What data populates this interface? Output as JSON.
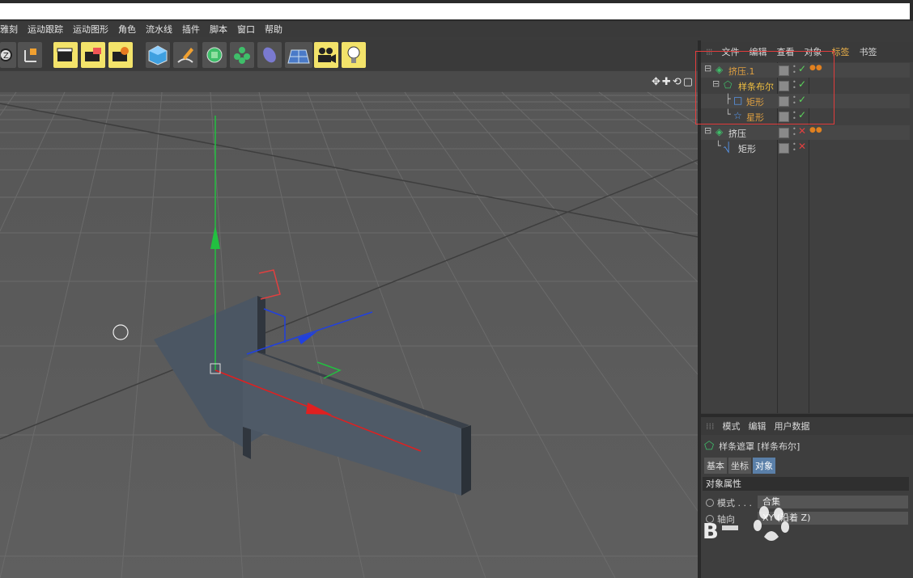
{
  "menubar": {
    "items": [
      "雅刻",
      "运动跟踪",
      "运动图形",
      "角色",
      "流水线",
      "插件",
      "脚本",
      "窗口",
      "帮助"
    ]
  },
  "toolbar": {
    "icons": [
      "undo-icon",
      "coordinate-icon",
      "render-view-icon",
      "render-picture-icon",
      "render-settings-icon",
      "cube-icon",
      "pen-icon",
      "subdivision-icon",
      "cloner-icon",
      "deformer-icon",
      "floor-icon",
      "camera-icon",
      "light-icon"
    ]
  },
  "object_manager": {
    "tabs": [
      "文件",
      "编辑",
      "查看",
      "对象",
      "标签",
      "书签"
    ],
    "active_tab_index": 4,
    "rows": [
      {
        "name": "挤压.1",
        "color": "#e0a040",
        "indent": 0,
        "mark": "check"
      },
      {
        "name": "样条布尔",
        "color": "#f0c040",
        "indent": 1,
        "mark": "check"
      },
      {
        "name": "矩形",
        "color": "#e0a040",
        "indent": 2,
        "mark": "check"
      },
      {
        "name": "星形",
        "color": "#e0a040",
        "indent": 2,
        "mark": "check"
      },
      {
        "name": "挤压",
        "color": "#dddddd",
        "indent": 0,
        "mark": "cross"
      },
      {
        "name": "矩形",
        "color": "#dddddd",
        "indent": 1,
        "mark": "cross"
      }
    ]
  },
  "attribute_manager": {
    "tabs": [
      "模式",
      "编辑",
      "用户数据"
    ],
    "title": "样条遮罩 [样条布尔]",
    "subtabs": [
      "基本",
      "坐标",
      "对象"
    ],
    "selected_subtab_index": 2,
    "section": "对象属性",
    "fields": [
      {
        "label": "模式 . . .",
        "value": "合集"
      },
      {
        "label": "轴向",
        "value": "XY (沿着 Z)"
      }
    ]
  },
  "colors": {
    "accent_orange": "#f0b44a",
    "highlight_red": "#e23c3c",
    "selected_tab_blue": "#5a7fa8"
  }
}
